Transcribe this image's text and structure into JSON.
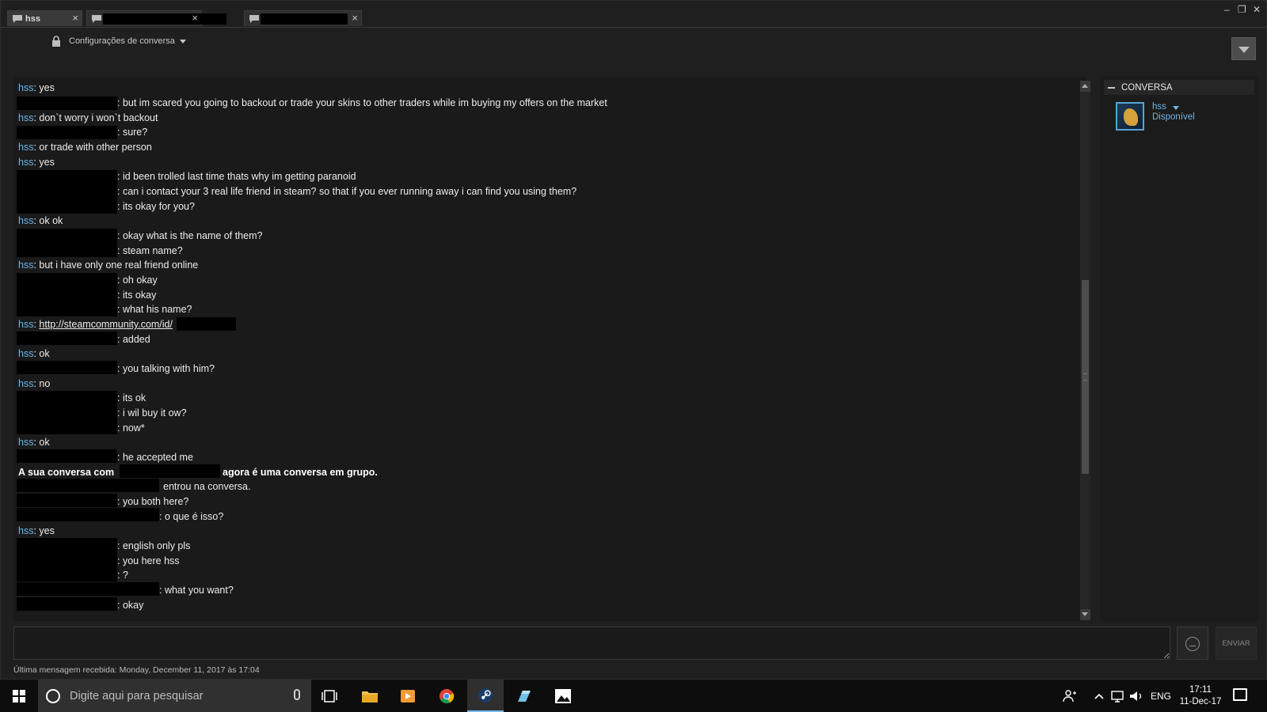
{
  "tabs": [
    {
      "label": "hss",
      "close": "×"
    },
    {
      "label": "",
      "close": "×"
    },
    {
      "label": "",
      "close": "×"
    }
  ],
  "window_controls": {
    "minimize": "–",
    "restore": "❐",
    "close": "✕"
  },
  "settings_label": "Configurações de conversa",
  "messages": [
    {
      "name": "hss",
      "text": ": yes"
    },
    {
      "name": "",
      "text": ": but im scared you going to backout or trade your skins to other traders while im buying my offers on the market"
    },
    {
      "name": "hss",
      "text": ": don`t worry i won`t backout"
    },
    {
      "name": "",
      "text": ": sure?"
    },
    {
      "name": "hss",
      "text": ": or trade with other person"
    },
    {
      "name": "hss",
      "text": ": yes"
    },
    {
      "name": "",
      "text": ": id been trolled last time thats why im getting paranoid"
    },
    {
      "name": "",
      "text": ": can i contact your 3 real life friend in steam? so that if you ever running away i can find you using them?"
    },
    {
      "name": "",
      "text": ": its okay for you?"
    },
    {
      "name": "hss",
      "text": ": ok ok"
    },
    {
      "name": "",
      "text": ": okay what is the name of them?"
    },
    {
      "name": "",
      "text": ": steam name?"
    },
    {
      "name": "hss",
      "text": ": but i have only one real friend online"
    },
    {
      "name": "",
      "text": ": oh okay"
    },
    {
      "name": "",
      "text": ": its okay"
    },
    {
      "name": "",
      "text": ": what his name?"
    },
    {
      "name": "hss",
      "text": ": ",
      "link": "http://steamcommunity.com/id/"
    },
    {
      "name": "",
      "text": ": added"
    },
    {
      "name": "hss",
      "text": ": ok"
    },
    {
      "name": "",
      "text": ": you talking with him?"
    },
    {
      "name": "hss",
      "text": ": no"
    },
    {
      "name": "",
      "text": ": its ok"
    },
    {
      "name": "",
      "text": ": i wil buy it ow?"
    },
    {
      "name": "",
      "text": ": now*"
    },
    {
      "name": "hss",
      "text": ": ok"
    },
    {
      "name": "",
      "text": ": he accepted me"
    },
    {
      "system_a": "A sua conversa com",
      "system_b": "agora é uma conversa em grupo."
    },
    {
      "system_c": "entrou na conversa."
    },
    {
      "name": "",
      "text": ": you both here?"
    },
    {
      "name": "",
      "text": ": o que é isso?"
    },
    {
      "name": "hss",
      "text": ": yes"
    },
    {
      "name": "",
      "text": ": english only pls"
    },
    {
      "name": "",
      "text": ": you here hss"
    },
    {
      "name": "",
      "text": ": ?"
    },
    {
      "name": "",
      "text": ": what you want?"
    },
    {
      "name": "",
      "text": ": okay"
    }
  ],
  "members": {
    "header": "CONVERSA",
    "name": "hss",
    "status": "Disponível"
  },
  "input": {
    "placeholder": "",
    "value": ""
  },
  "send_label": "ENVIAR",
  "last_message": "Última mensagem recebida: Monday, December 11, 2017 às 17:04",
  "taskbar": {
    "search_placeholder": "Digite aqui para pesquisar",
    "lang": "ENG",
    "time": "17:11",
    "date": "11-Dec-17"
  },
  "colors": {
    "name": "#6fb5e6",
    "background": "#1f1f1f",
    "taskbar": "#0d0d0d"
  }
}
